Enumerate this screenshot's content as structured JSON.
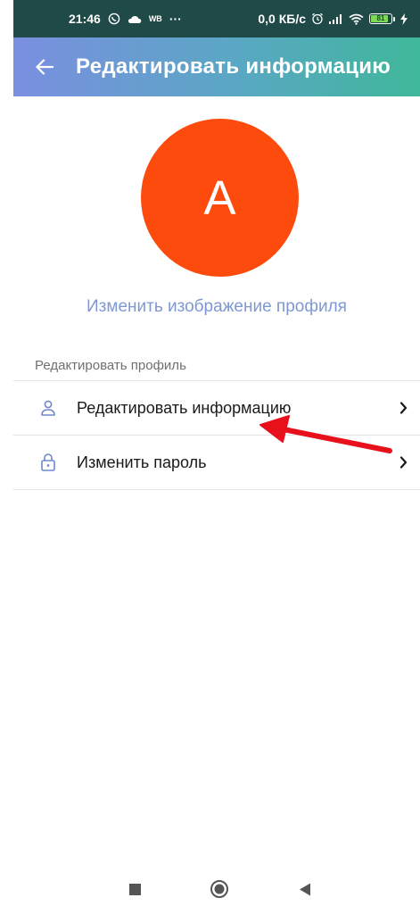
{
  "status_bar": {
    "time": "21:46",
    "wb_label": "WB",
    "dots": "···",
    "speed": "0,0 КБ/с",
    "battery": "81",
    "icons": [
      "whatsapp-icon",
      "cloud-icon",
      "alarm-icon",
      "signal-icon",
      "wifi-icon",
      "battery-icon",
      "charging-icon"
    ]
  },
  "app_bar": {
    "title": "Редактировать информацию",
    "back_icon": "arrow-left-icon"
  },
  "profile": {
    "avatar_letter": "A",
    "avatar_color": "#fc4b0d",
    "change_photo_label": "Изменить изображение профиля"
  },
  "section": {
    "header": "Редактировать профиль",
    "items": [
      {
        "label": "Редактировать информацию",
        "icon": "person-icon"
      },
      {
        "label": "Изменить пароль",
        "icon": "lock-icon"
      }
    ]
  },
  "colors": {
    "accent": "#7f98d3",
    "status_bar": "#1f4a47",
    "annotation": "#e8101a"
  },
  "nav_bar": {
    "icons": [
      "recents-square-icon",
      "home-circle-icon",
      "back-triangle-icon"
    ]
  }
}
